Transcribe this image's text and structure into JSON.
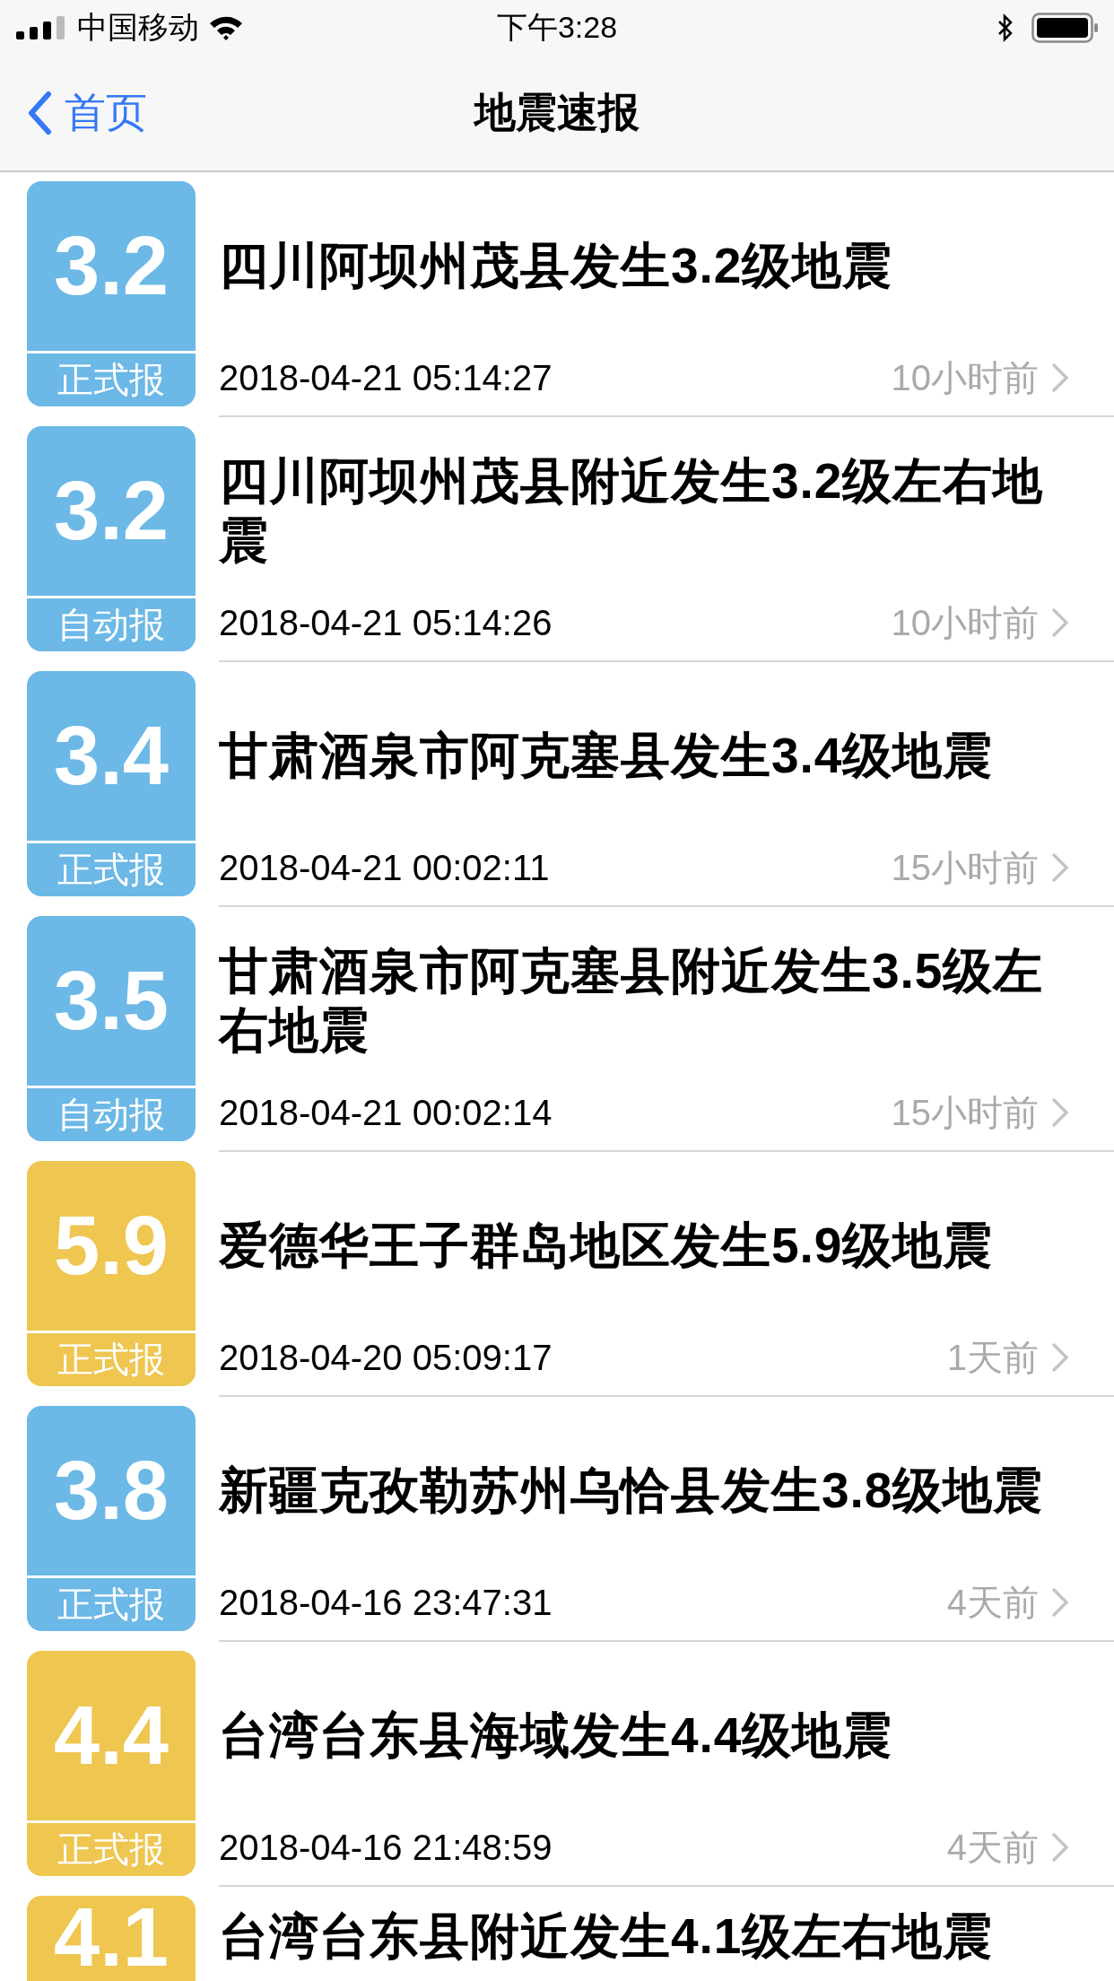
{
  "status_bar": {
    "carrier": "中国移动",
    "time": "下午3:28"
  },
  "nav": {
    "back": "首页",
    "title": "地震速报"
  },
  "quakes": [
    {
      "magnitude": "3.2",
      "report": "正式报",
      "color": "#6cb8e6",
      "title": "四川阿坝州茂县发生3.2级地震",
      "time": "2018-04-21 05:14:27",
      "ago": "10小时前"
    },
    {
      "magnitude": "3.2",
      "report": "自动报",
      "color": "#6cb8e6",
      "title": "四川阿坝州茂县附近发生3.2级左右地震",
      "time": "2018-04-21 05:14:26",
      "ago": "10小时前"
    },
    {
      "magnitude": "3.4",
      "report": "正式报",
      "color": "#6cb8e6",
      "title": "甘肃酒泉市阿克塞县发生3.4级地震",
      "time": "2018-04-21 00:02:11",
      "ago": "15小时前"
    },
    {
      "magnitude": "3.5",
      "report": "自动报",
      "color": "#6cb8e6",
      "title": "甘肃酒泉市阿克塞县附近发生3.5级左右地震",
      "time": "2018-04-21 00:02:14",
      "ago": "15小时前"
    },
    {
      "magnitude": "5.9",
      "report": "正式报",
      "color": "#eec650",
      "title": "爱德华王子群岛地区发生5.9级地震",
      "time": "2018-04-20 05:09:17",
      "ago": "1天前"
    },
    {
      "magnitude": "3.8",
      "report": "正式报",
      "color": "#6cb8e6",
      "title": "新疆克孜勒苏州乌恰县发生3.8级地震",
      "time": "2018-04-16 23:47:31",
      "ago": "4天前"
    },
    {
      "magnitude": "4.4",
      "report": "正式报",
      "color": "#eec650",
      "title": "台湾台东县海域发生4.4级地震",
      "time": "2018-04-16 21:48:59",
      "ago": "4天前"
    },
    {
      "magnitude": "4.1",
      "color": "#eec650",
      "title": "台湾台东县附近发生4.1级左右地震"
    }
  ]
}
